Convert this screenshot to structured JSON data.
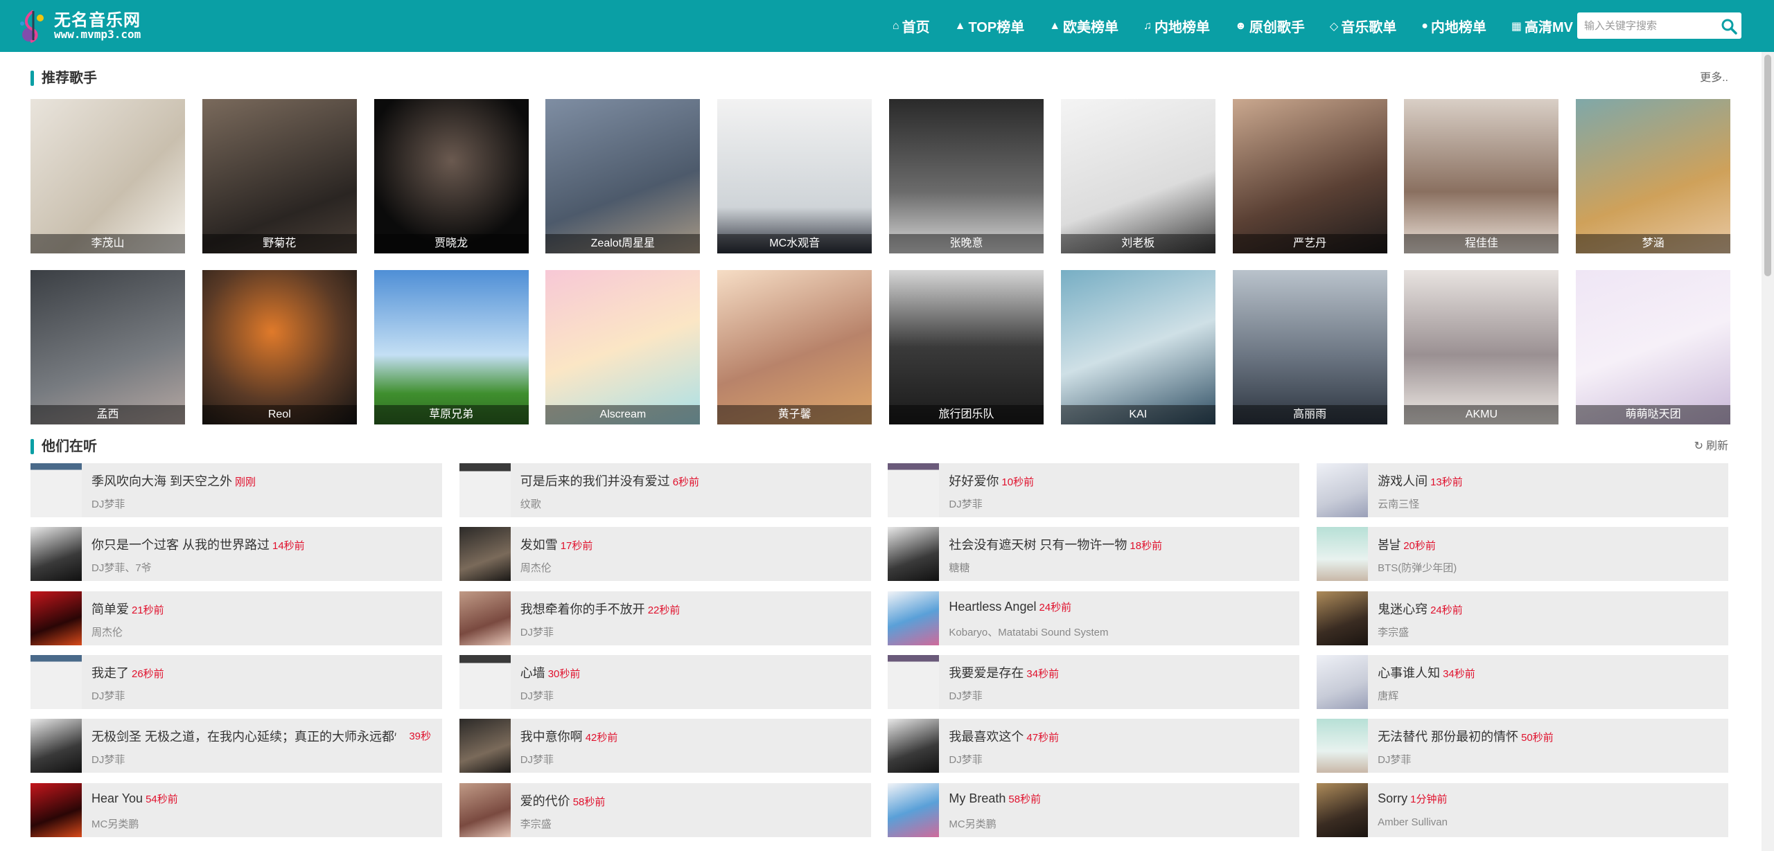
{
  "header": {
    "logo_name": "无名音乐网",
    "logo_url": "www.mvmp3.com",
    "nav": [
      {
        "label": "首页",
        "icon": "home-icon"
      },
      {
        "label": "TOP榜单",
        "icon": "thumbs-up-icon"
      },
      {
        "label": "欧美榜单",
        "icon": "thumbs-up-icon"
      },
      {
        "label": "内地榜单",
        "icon": "music-note-icon"
      },
      {
        "label": "原创歌手",
        "icon": "user-circle-icon"
      },
      {
        "label": "音乐歌单",
        "icon": "diamond-icon"
      },
      {
        "label": "内地榜单",
        "icon": "circle-icon"
      },
      {
        "label": "高清MV",
        "icon": "film-icon"
      }
    ],
    "search_placeholder": "输入关键字搜索"
  },
  "recommended": {
    "title": "推荐歌手",
    "more": "更多..",
    "singers": [
      "李茂山",
      "野菊花",
      "贾晓龙",
      "Zealot周星星",
      "MC水观音",
      "张晚意",
      "刘老板",
      "严艺丹",
      "程佳佳",
      "梦涵",
      "孟西",
      "Reol",
      "草原兄弟",
      "Alscream",
      "黄子馨",
      "旅行团乐队",
      "KAI",
      "高丽雨",
      "AKMU",
      "萌萌哒天团"
    ]
  },
  "listening": {
    "title": "他们在听",
    "refresh": "刷新",
    "items": [
      {
        "song": "季风吹向大海 到天空之外",
        "time": "刚刚",
        "artist": "DJ梦菲"
      },
      {
        "song": "可是后来的我们并没有爱过",
        "time": "6秒前",
        "artist": "纹歌"
      },
      {
        "song": "好好爱你",
        "time": "10秒前",
        "artist": "DJ梦菲"
      },
      {
        "song": "游戏人间",
        "time": "13秒前",
        "artist": "云南三怪"
      },
      {
        "song": "你只是一个过客 从我的世界路过",
        "time": "14秒前",
        "artist": "DJ梦菲、7爷"
      },
      {
        "song": "发如雪",
        "time": "17秒前",
        "artist": "周杰伦"
      },
      {
        "song": "社会没有遮天树 只有一物许一物",
        "time": "18秒前",
        "artist": "糖糖"
      },
      {
        "song": "봄날",
        "time": "20秒前",
        "artist": "BTS(防弹少年团)"
      },
      {
        "song": "简单爱",
        "time": "21秒前",
        "artist": "周杰伦"
      },
      {
        "song": "我想牵着你的手不放开",
        "time": "22秒前",
        "artist": "DJ梦菲"
      },
      {
        "song": "Heartless Angel",
        "time": "24秒前",
        "artist": "Kobaryo、Matatabi Sound System"
      },
      {
        "song": "鬼迷心窍",
        "time": "24秒前",
        "artist": "李宗盛"
      },
      {
        "song": "我走了",
        "time": "26秒前",
        "artist": "DJ梦菲"
      },
      {
        "song": "心墙",
        "time": "30秒前",
        "artist": "DJ梦菲"
      },
      {
        "song": "我要爱是存在",
        "time": "34秒前",
        "artist": "DJ梦菲"
      },
      {
        "song": "心事谁人知",
        "time": "34秒前",
        "artist": "唐辉"
      },
      {
        "song": "无极剑圣 无极之道，在我内心延续；真正的大师永远都怀",
        "time": "39秒",
        "artist": "DJ梦菲"
      },
      {
        "song": "我中意你啊",
        "time": "42秒前",
        "artist": "DJ梦菲"
      },
      {
        "song": "我最喜欢这个",
        "time": "47秒前",
        "artist": "DJ梦菲"
      },
      {
        "song": "无法替代 那份最初的情怀",
        "time": "50秒前",
        "artist": "DJ梦菲"
      },
      {
        "song": "Hear You",
        "time": "54秒前",
        "artist": "MC另类鹏"
      },
      {
        "song": "爱的代价",
        "time": "58秒前",
        "artist": "李宗盛"
      },
      {
        "song": "My Breath",
        "time": "58秒前",
        "artist": "MC另类鹏"
      },
      {
        "song": "Sorry",
        "time": "1分钟前",
        "artist": "Amber Sullivan"
      }
    ]
  },
  "colors": {
    "accent": "#0a9fa5",
    "time": "#e0102c"
  }
}
